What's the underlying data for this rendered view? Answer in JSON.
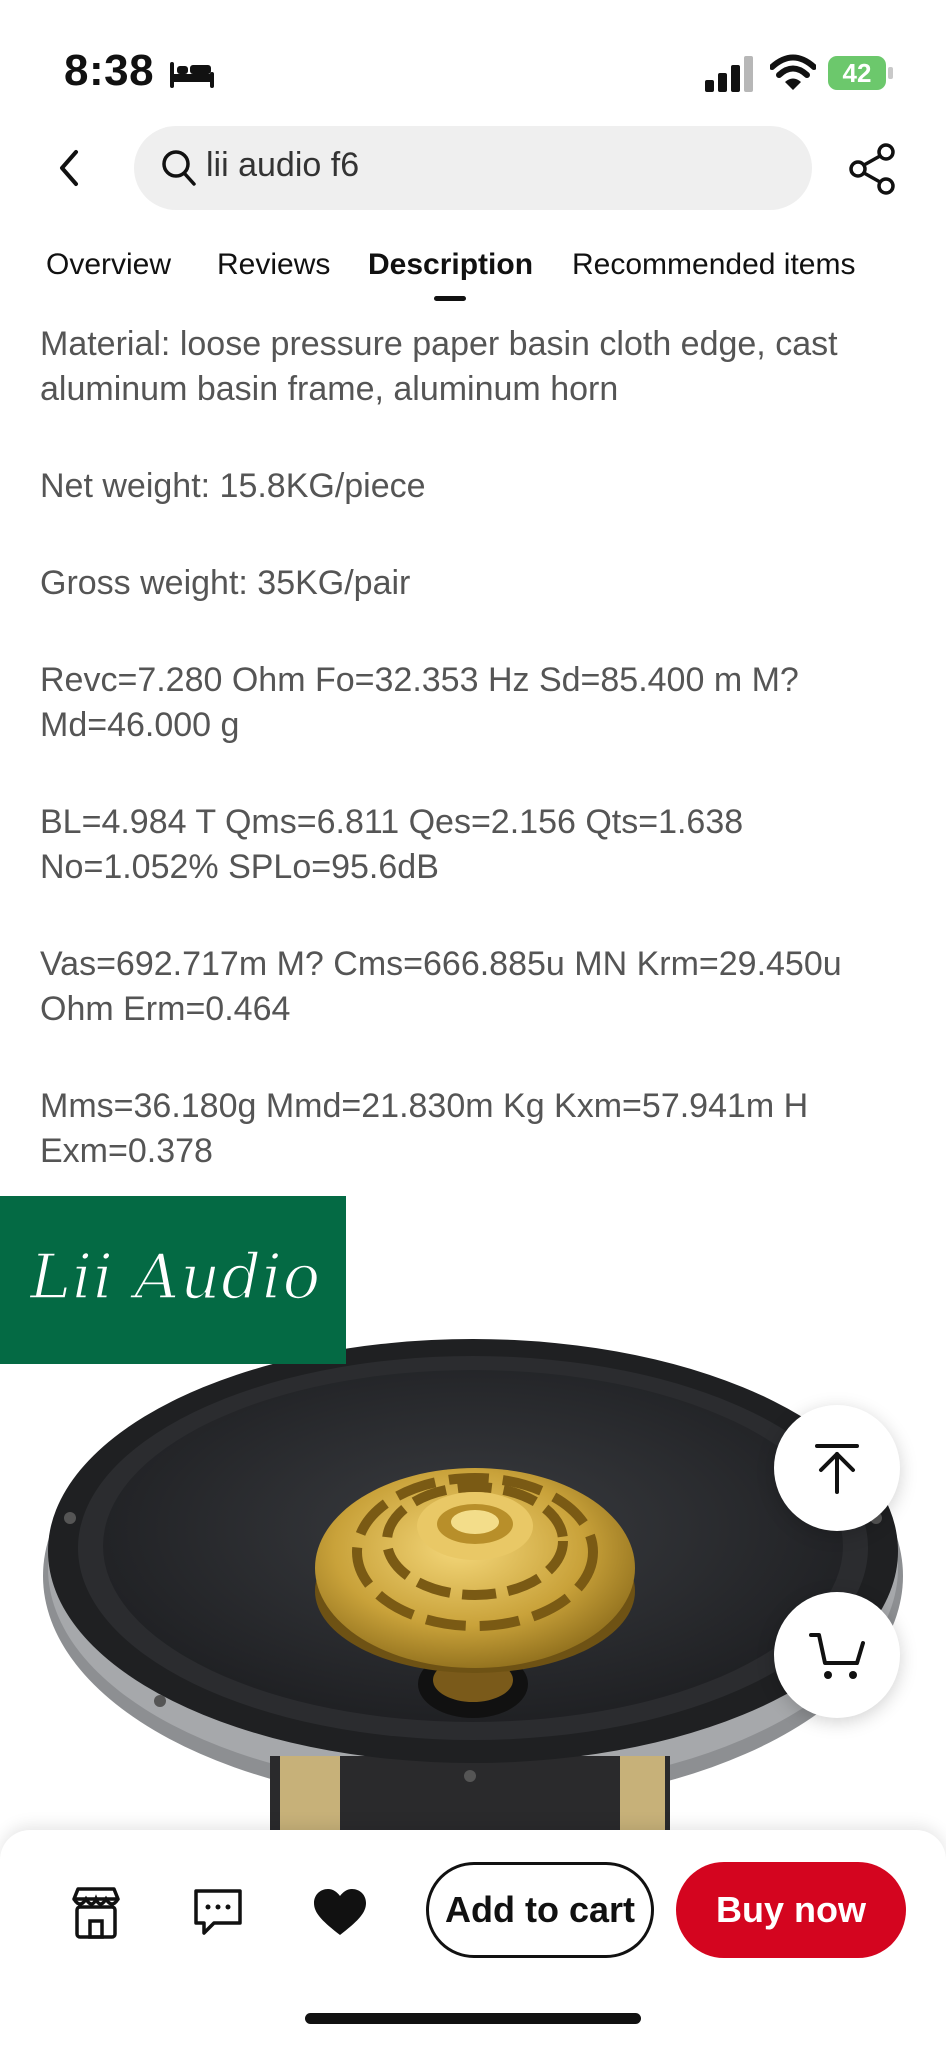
{
  "status_bar": {
    "time": "8:38",
    "battery": "42",
    "icons": [
      "bed-icon",
      "signal-icon",
      "wifi-icon",
      "battery-icon"
    ]
  },
  "header": {
    "search_text": "lii audio f6",
    "icons": [
      "back-chevron-icon",
      "search-icon",
      "share-icon"
    ]
  },
  "tabs": [
    {
      "label": "Overview"
    },
    {
      "label": "Reviews"
    },
    {
      "label": "Description",
      "active": true
    },
    {
      "label": "Recommended items"
    }
  ],
  "description": [
    "Material: loose pressure paper basin cloth edge, cast aluminum basin frame, aluminum horn",
    "Net weight: 15.8KG/piece",
    "Gross weight: 35KG/pair",
    "Revc=7.280 Ohm Fo=32.353 Hz Sd=85.400 m M? Md=46.000 g",
    "BL=4.984 T Qms=6.811 Qes=2.156 Qts=1.638 No=1.052% SPLo=95.6dB",
    "Vas=692.717m M? Cms=666.885u MN Krm=29.450u Ohm Erm=0.464",
    "Mms=36.180g Mmd=21.830m Kg Kxm=57.941m H Exm=0.378"
  ],
  "product_image": {
    "brand_logo": "Lii Audio",
    "brand_color": "#046a44"
  },
  "floating": {
    "icons": [
      "arrow-up-to-top-icon",
      "cart-icon"
    ]
  },
  "bottom_bar": {
    "add_to_cart": "Add to cart",
    "buy_now": "Buy now",
    "buy_color": "#d4051f",
    "icons": [
      "store-icon",
      "chat-icon",
      "heart-icon"
    ]
  }
}
